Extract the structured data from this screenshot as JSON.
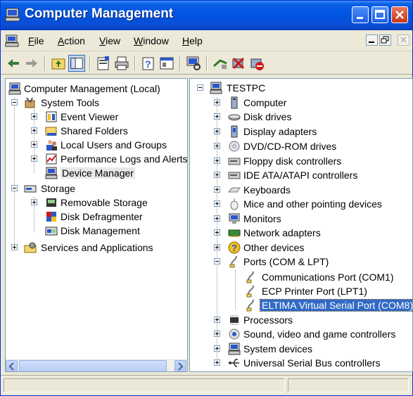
{
  "window": {
    "title": "Computer Management"
  },
  "menu": {
    "file": {
      "accel": "F",
      "rest": "ile"
    },
    "action": {
      "accel": "A",
      "rest": "ction"
    },
    "view": {
      "accel": "V",
      "rest": "iew"
    },
    "window": {
      "accel": "W",
      "rest": "indow"
    },
    "help": {
      "accel": "H",
      "rest": "elp"
    }
  },
  "left_tree": [
    {
      "label": "Computer Management (Local)",
      "icon": "computer-icon"
    },
    {
      "label": "System Tools",
      "icon": "tools-icon"
    },
    {
      "label": "Event Viewer",
      "icon": "event-viewer-icon"
    },
    {
      "label": "Shared Folders",
      "icon": "shared-folder-icon"
    },
    {
      "label": "Local Users and Groups",
      "icon": "users-icon"
    },
    {
      "label": "Performance Logs and Alerts",
      "icon": "performance-icon"
    },
    {
      "label": "Device Manager",
      "icon": "device-manager-icon"
    },
    {
      "label": "Storage",
      "icon": "storage-icon"
    },
    {
      "label": "Removable Storage",
      "icon": "removable-storage-icon"
    },
    {
      "label": "Disk Defragmenter",
      "icon": "defrag-icon"
    },
    {
      "label": "Disk Management",
      "icon": "disk-management-icon"
    },
    {
      "label": "Services and Applications",
      "icon": "services-icon"
    }
  ],
  "right_tree": [
    {
      "label": "TESTPC",
      "icon": "computer-icon"
    },
    {
      "label": "Computer",
      "icon": "computer-icon"
    },
    {
      "label": "Disk drives",
      "icon": "disk-drive-icon"
    },
    {
      "label": "Display adapters",
      "icon": "display-adapter-icon"
    },
    {
      "label": "DVD/CD-ROM drives",
      "icon": "cdrom-icon"
    },
    {
      "label": "Floppy disk controllers",
      "icon": "floppy-icon"
    },
    {
      "label": "IDE ATA/ATAPI controllers",
      "icon": "ide-icon"
    },
    {
      "label": "Keyboards",
      "icon": "keyboard-icon"
    },
    {
      "label": "Mice and other pointing devices",
      "icon": "mouse-icon"
    },
    {
      "label": "Monitors",
      "icon": "monitor-icon"
    },
    {
      "label": "Network adapters",
      "icon": "network-icon"
    },
    {
      "label": "Other devices",
      "icon": "unknown-device-icon"
    },
    {
      "label": "Ports (COM & LPT)",
      "icon": "port-icon"
    },
    {
      "label": "Communications Port (COM1)",
      "icon": "port-icon"
    },
    {
      "label": "ECP Printer Port (LPT1)",
      "icon": "port-icon"
    },
    {
      "label": "ELTIMA Virtual Serial Port (COM8)",
      "icon": "port-icon"
    },
    {
      "label": "Processors",
      "icon": "processor-icon"
    },
    {
      "label": "Sound, video and game controllers",
      "icon": "sound-icon"
    },
    {
      "label": "System devices",
      "icon": "system-device-icon"
    },
    {
      "label": "Universal Serial Bus controllers",
      "icon": "usb-icon"
    }
  ],
  "colors": {
    "titlebar": "#0054e3",
    "selection": "#316ac5",
    "chrome": "#ece9d8"
  }
}
